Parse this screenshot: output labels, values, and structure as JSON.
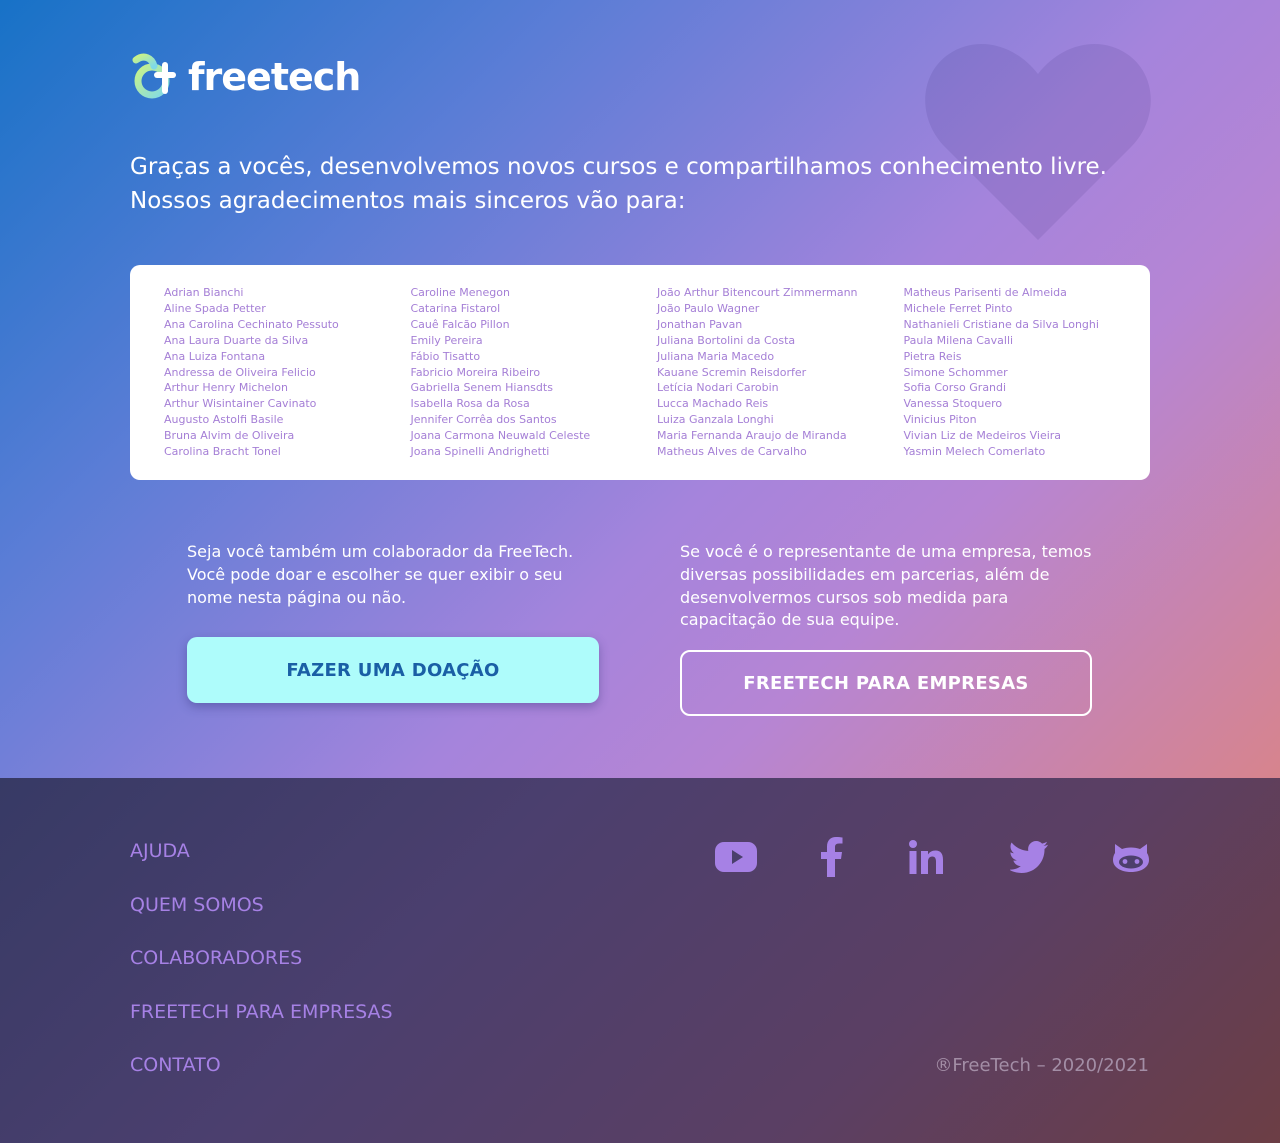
{
  "brand": {
    "name": "freetech",
    "colors": {
      "accent": "#a681e5",
      "donate_bg": "#aefcfb",
      "donate_text": "#1a5fa5",
      "names": "#a57fd6"
    }
  },
  "intro": {
    "line1": "Graças a vocês, desenvolvemos novos cursos e compartilhamos conhecimento livre.",
    "line2": "Nossos agradecimentos mais sinceros vão para:"
  },
  "contributors": [
    [
      "Adrian Bianchi",
      "Aline Spada Petter",
      "Ana Carolina Cechinato Pessuto",
      "Ana Laura Duarte da Silva",
      "Ana Luiza Fontana",
      "Andressa de Oliveira Felicio",
      "Arthur Henry Michelon",
      "Arthur Wisintainer Cavinato",
      "Augusto Astolfi Basile",
      "Bruna Alvim de Oliveira",
      "Carolina Bracht Tonel"
    ],
    [
      "Caroline Menegon",
      "Catarina Fistarol",
      "Cauê Falcão Pillon",
      "Emily Pereira",
      "Fábio Tisatto",
      "Fabricio Moreira Ribeiro",
      "Gabriella Senem Hiansdts",
      "Isabella Rosa da Rosa",
      "Jennifer Corrêa dos Santos",
      "Joana Carmona Neuwald Celeste",
      "Joana Spinelli Andrighetti"
    ],
    [
      "João Arthur Bitencourt Zimmermann",
      "João Paulo Wagner",
      "Jonathan Pavan",
      "Juliana Bortolini da Costa",
      "Juliana Maria Macedo",
      "Kauane Scremin Reisdorfer",
      "Letícia Nodari Carobin",
      "Lucca Machado Reis",
      "Luiza Ganzala Longhi",
      "Maria Fernanda Araujo de Miranda",
      "Matheus Alves de Carvalho"
    ],
    [
      "Matheus Parisenti de Almeida",
      "Michele Ferret Pinto",
      "Nathanieli Cristiane da Silva Longhi",
      "Paula Milena Cavalli",
      "Pietra Reis",
      "Simone Schommer",
      "Sofia Corso Grandi",
      "Vanessa Stoquero",
      "Vinicius Piton",
      "Vivian Liz de Medeiros Vieira",
      "Yasmin Melech Comerlato"
    ]
  ],
  "cta": {
    "left_text": "Seja você também um colaborador da FreeTech. Você pode doar e escolher se quer exibir o seu nome nesta página ou não.",
    "left_button": "FAZER UMA DOAÇÃO",
    "right_text": "Se você é o representante de uma empresa, temos diversas possibilidades em parcerias, além de desenvolvermos cursos sob medida para capacitação de sua equipe.",
    "right_button": "FREETECH PARA EMPRESAS"
  },
  "footer": {
    "links": [
      "AJUDA",
      "QUEM SOMOS",
      "COLABORADORES",
      "FREETECH PARA EMPRESAS",
      "CONTATO"
    ],
    "socials": [
      "youtube-icon",
      "facebook-icon",
      "linkedin-icon",
      "twitter-icon",
      "github-icon"
    ],
    "copyright": "®FreeTech – 2020/2021"
  }
}
